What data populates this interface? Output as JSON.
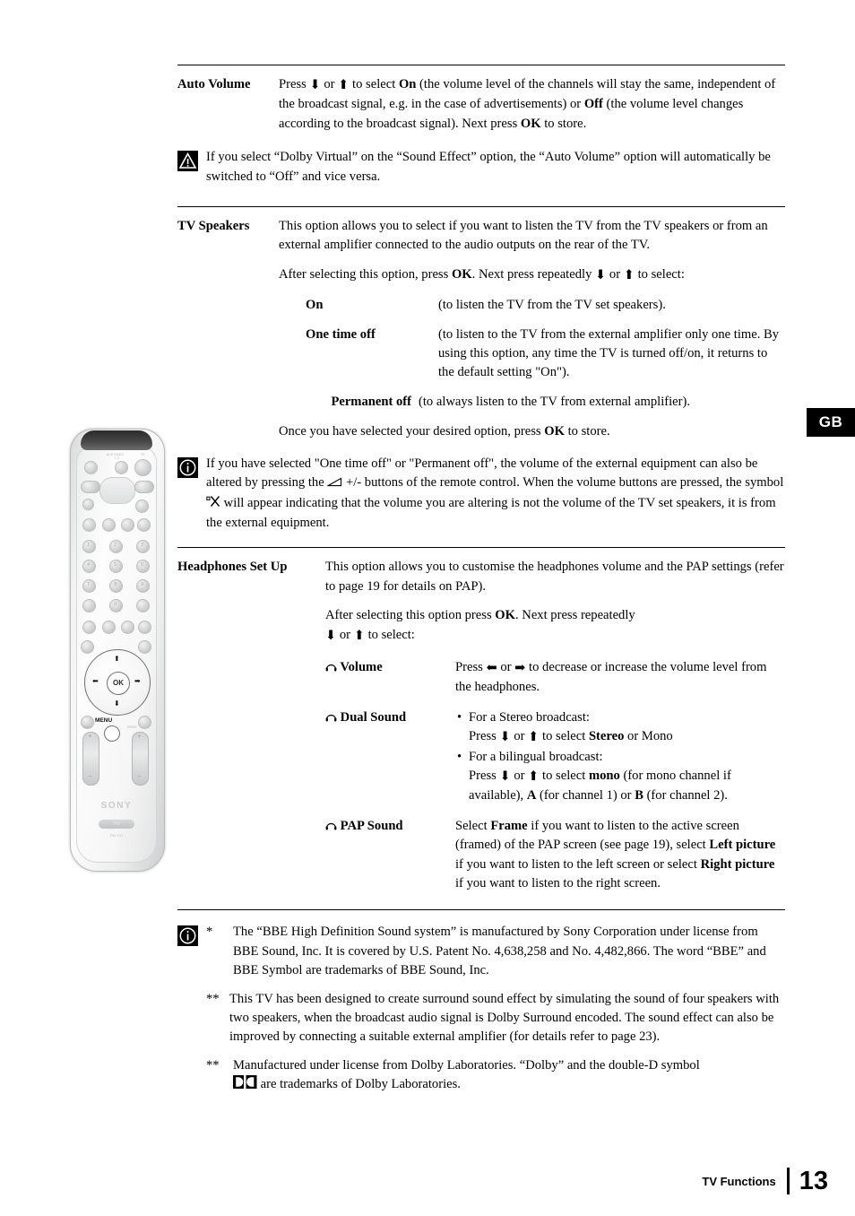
{
  "page": {
    "language_tab": "GB",
    "footer_label": "TV Functions",
    "footer_page_number": "13"
  },
  "sections": [
    {
      "id": "auto-volume",
      "term": "Auto Volume",
      "paragraphs": [
        "Press ⬇ or ⬆ to select On (the volume level of the channels will stay the same, independent of the broadcast signal, e.g. in the case of advertisements) or Off (the volume level changes according to the broadcast signal). Next press OK to store."
      ],
      "note": {
        "icon": "warning-triangle-icon",
        "text": "If you select “Dolby Virtual” on the “Sound Effect” option, the “Auto Volume” option will automatically be switched to “Off” and vice versa."
      }
    },
    {
      "id": "tv-speakers",
      "term": "TV Speakers",
      "paragraphs": [
        "This option allows you to select if you want to listen the TV from the TV speakers or from an external amplifier connected to the audio outputs on the rear of the TV.",
        "After selecting this option, press OK. Next press repeatedly ⬇ or ⬆ to select:"
      ],
      "options": [
        {
          "label": "On",
          "description": "(to listen the TV from the TV set speakers)."
        },
        {
          "label": "One time off",
          "description": "(to listen to the TV from the external amplifier only one time. By using this option, any time the TV is turned off/on, it returns to the default setting \"On\")."
        },
        {
          "label": "Permanent off",
          "description": "(to always listen to the TV from external amplifier)."
        }
      ],
      "closing": "Once you have selected your desired option, press OK to store.",
      "note": {
        "icon": "info-circle-icon",
        "text": "If you have selected \"One time off\" or \"Permanent off\", the volume of the external equipment can also be altered by pressing the ◢ +/- buttons of the remote control. When the volume buttons are pressed, the symbol °✕ will appear indicating that the volume you are altering is not the volume of the TV set speakers, it is from the external equipment."
      }
    },
    {
      "id": "headphones-set-up",
      "term": "Headphones Set Up",
      "paragraphs": [
        "This option allows you to customise the headphones volume and the PAP settings (refer to page 19 for details on PAP).",
        "After selecting this option press OK. Next press repeatedly ⬇ or ⬆ to select:"
      ],
      "options": [
        {
          "icon": "headphones-icon",
          "label": "Volume",
          "description": "Press ⬅ or ➡ to decrease or increase the volume level from the headphones."
        },
        {
          "icon": "headphones-icon",
          "label": "Dual Sound",
          "description": "• For a Stereo broadcast: Press ⬇ or ⬆ to select Stereo or Mono • For a bilingual broadcast: Press ⬇ or ⬆ to select mono (for mono channel if available), A (for channel 1) or B (for channel 2)."
        },
        {
          "icon": "headphones-icon",
          "label": "PAP Sound",
          "description": "Select Frame if you want to listen to the active screen (framed) of the PAP screen (see page 19), select Left picture if you want to listen to the left screen or select Right picture if you want to listen to the right screen."
        }
      ]
    }
  ],
  "text": {
    "auto_volume_body": {
      "t1": "Press ",
      "t2": " or ",
      "t3": " to select ",
      "on": "On",
      "t4": " (the volume level of the channels will stay the same, independent of the broadcast signal, e.g. in the case of advertisements) or ",
      "off": "Off",
      "t5": " (the volume level changes according to the broadcast signal). Next press ",
      "ok": "OK",
      "t6": " to store."
    },
    "warn_note": "If you select “Dolby Virtual” on the “Sound Effect” option, the “Auto Volume” option will automatically be switched to “Off” and vice versa.",
    "tv_speakers_p1": "This option allows you to select if you want to listen the TV from the TV speakers or from an external amplifier connected to the audio outputs on the rear of the TV.",
    "tv_speakers_p2a": "After selecting this option, press ",
    "tv_speakers_ok": "OK",
    "tv_speakers_p2b": ". Next press repeatedly ",
    "tv_speakers_p2c": " or ",
    "tv_speakers_p2d": " to select:",
    "opt_on_label": "On",
    "opt_on_desc": "(to listen the TV from the TV set speakers).",
    "opt_onetime_label": "One time off",
    "opt_onetime_desc": "(to listen to the TV from the external amplifier only one time. By using this option, any time the TV is turned off/on, it returns to the default setting \"On\").",
    "opt_perm_label": "Permanent off",
    "opt_perm_desc": "(to always listen to the TV from external amplifier).",
    "tv_speakers_close_a": "Once you have selected your desired option, press ",
    "tv_speakers_close_ok": "OK",
    "tv_speakers_close_b": " to store.",
    "info_note_a": "If you have selected \"One time off\" or \"Permanent off\", the volume of the external equipment can also be altered by pressing the ",
    "info_note_b": " +/- buttons of the remote control. When the volume buttons are pressed, the symbol ",
    "info_note_c": " will appear indicating that the volume you are altering is not the volume of the TV set speakers, it is from the external equipment.",
    "headphones_p1": "This option allows you to customise the headphones volume and the PAP settings (refer to page 19 for details on PAP).",
    "headphones_p2a": "After selecting this option press ",
    "headphones_ok": "OK",
    "headphones_p2b": ". Next press repeatedly",
    "headphones_p2c": " or ",
    "headphones_p2d": " to select:",
    "hp_volume_label": "Volume",
    "hp_volume_a": "Press ",
    "hp_volume_b": " or ",
    "hp_volume_c": " to decrease or increase the volume level from the headphones.",
    "hp_dual_label": "Dual Sound",
    "hp_dual_b1": "For a Stereo broadcast:",
    "hp_dual_b1_a": "Press ",
    "hp_dual_b1_b": " or ",
    "hp_dual_b1_c": " to select ",
    "hp_dual_b1_stereo": "Stereo",
    "hp_dual_b1_d": " or Mono",
    "hp_dual_b2": "For a bilingual broadcast:",
    "hp_dual_b2_a": "Press ",
    "hp_dual_b2_b": " or ",
    "hp_dual_b2_c": " to select ",
    "hp_dual_b2_mono": "mono",
    "hp_dual_b2_d": " (for mono channel if available), ",
    "hp_dual_b2_A": "A",
    "hp_dual_b2_e": " (for channel 1) or ",
    "hp_dual_b2_B": "B",
    "hp_dual_b2_f": " (for channel 2).",
    "hp_pap_label": "PAP Sound",
    "hp_pap_a": "Select ",
    "hp_pap_frame": "Frame",
    "hp_pap_b": " if you want to listen to the active screen (framed) of the PAP screen (see page 19), select ",
    "hp_pap_left": "Left picture",
    "hp_pap_c": " if you want to listen to the left screen or select ",
    "hp_pap_right": "Right picture",
    "hp_pap_d": " if you want to listen to the right screen."
  },
  "footnotes": [
    {
      "mark": "*",
      "text": "The “BBE High Definition Sound system” is manufactured by Sony Corporation under license  from BBE Sound, Inc. It is covered by U.S. Patent No. 4,638,258 and No. 4,482,866. The word “BBE” and BBE Symbol are trademarks of BBE Sound, Inc."
    },
    {
      "mark": "**",
      "text": "This TV has been designed to create surround sound effect by simulating the sound of four speakers with two speakers, when the broadcast audio signal is Dolby Surround encoded. The sound effect can also be improved by connecting a suitable external amplifier (for details refer to page 23)."
    },
    {
      "mark": "**",
      "text": "Manufactured under license from Dolby Laboratories. “Dolby” and the double-D symbol ▮▮ are trademarks of Dolby Laboratories."
    }
  ],
  "footnote_parts": {
    "fn3_a": "Manufactured under license from Dolby Laboratories. “Dolby” and the double-D symbol",
    "fn3_b": " are trademarks of Dolby Laboratories."
  },
  "remote": {
    "labels": {
      "aux_video": "AUX VIDEO",
      "aux_sub": "I / II",
      "tv": "TV",
      "menu": "MENU",
      "ok": "OK",
      "sony": "SONY",
      "tv_pill": "TV",
      "rmc": "RM-943",
      "vol": "VOL",
      "prog": "PROG",
      "plus": "+",
      "minus": "–",
      "keys": [
        "1",
        "2",
        "3",
        "4",
        "5",
        "6",
        "7",
        "8",
        "9",
        "0"
      ]
    }
  },
  "colors": {
    "ink": "#000000",
    "paper": "#ffffff",
    "tab_background": "#000000",
    "tab_text": "#ffffff"
  }
}
